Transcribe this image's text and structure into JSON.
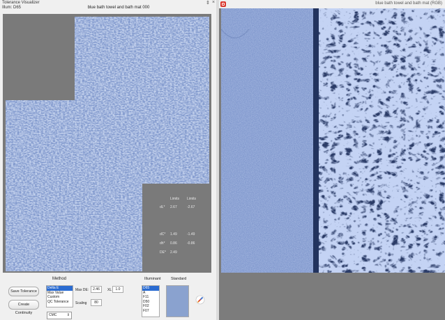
{
  "window": {
    "title": "Tolerance Visualizer",
    "illuminant_line": "Illum: D65",
    "image_name": "blue bath towel and bath mat 000",
    "controls": [
      "⇕",
      "×"
    ]
  },
  "stats": {
    "headers": [
      "Limits",
      "Limits"
    ],
    "rows": [
      {
        "label": "dL*",
        "v1": "2.67",
        "v2": "-2.67"
      },
      {
        "label": "dC*",
        "v1": "1.49",
        "v2": "-1.49"
      },
      {
        "label": "dh*",
        "v1": "0.86",
        "v2": "-0.86"
      },
      {
        "label": "DE*",
        "v1": "2.49",
        "v2": ""
      }
    ]
  },
  "method": {
    "title": "Method",
    "options": [
      "Delta E",
      "Max Value",
      "Custom",
      "QC Tolerance"
    ],
    "selected_index": 0,
    "max_de_label": "Max DE:",
    "max_de_value": "2.46",
    "xl_label": "XL",
    "xl_value": "1.0",
    "scaling_label": "Scaling",
    "scaling_value": "80",
    "formula": "CMC"
  },
  "buttons": {
    "save": "Save Tolerance",
    "create": "Create Continuity"
  },
  "illuminant": {
    "title": "Illuminant",
    "options": [
      "D65",
      "A",
      "F11",
      "D50",
      "F02",
      "F07"
    ],
    "selected_index": 0
  },
  "standard": {
    "title": "Standard",
    "color": "#8aa2cf"
  },
  "right_panel": {
    "title": "blue bath towel and bath mat (RGB)"
  },
  "colors": {
    "towel_light": "#8ea6d8",
    "towel_dark": "#5f78b0",
    "mat_dark": "#1f2f55",
    "viewer_bg": "#7a7a7a"
  }
}
